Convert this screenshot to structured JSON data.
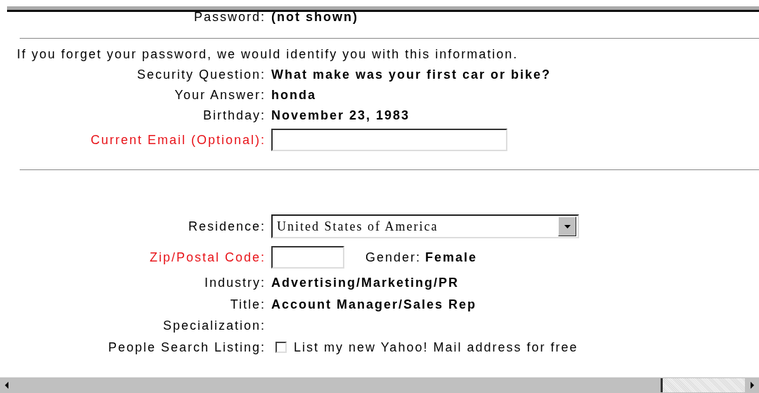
{
  "sections": [
    {
      "rows": [
        {
          "kind": "text",
          "label": "Password:",
          "highlighted": false,
          "value": "(not shown)"
        }
      ]
    },
    {
      "intro": "If you forget your password, we would identify you with this information.",
      "rows": [
        {
          "kind": "text",
          "label": "Security Question:",
          "highlighted": false,
          "value": "What make was your first car or bike?"
        },
        {
          "kind": "text",
          "label": "Your Answer:",
          "highlighted": false,
          "value": "honda"
        },
        {
          "kind": "text",
          "label": "Birthday:",
          "highlighted": false,
          "value": "November 23, 1983"
        },
        {
          "kind": "input",
          "label": "Current Email (Optional):",
          "highlighted": true
        }
      ]
    },
    {
      "rows": [
        {
          "kind": "select",
          "label": "Residence:",
          "highlighted": false,
          "value": "United States of America"
        },
        {
          "kind": "input",
          "label": "Zip/Postal Code:",
          "highlighted": true,
          "extra_label": "Gender:",
          "extra_value": "Female"
        },
        {
          "kind": "text",
          "label": "Industry:",
          "highlighted": false,
          "value": "Advertising/Marketing/PR"
        },
        {
          "kind": "text",
          "label": "Title:",
          "highlighted": false,
          "value": "Account Manager/Sales Rep"
        },
        {
          "kind": "empty",
          "label": "Specialization:",
          "highlighted": false
        },
        {
          "kind": "checkbox",
          "label": "People Search Listing:",
          "highlighted": false,
          "checked": false,
          "value": "List my new Yahoo! Mail address for free"
        }
      ]
    }
  ]
}
